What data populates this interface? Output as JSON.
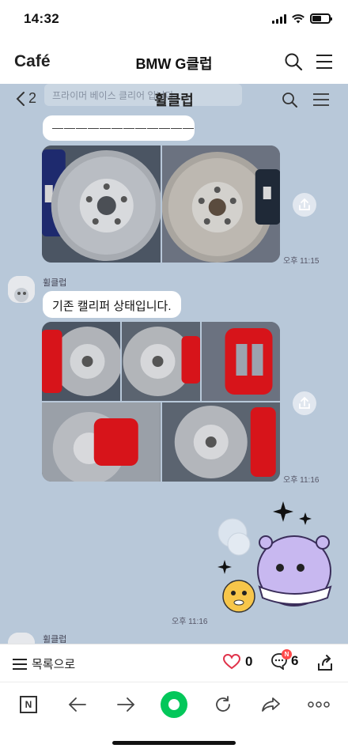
{
  "status_bar": {
    "time": "14:32"
  },
  "cafe_header": {
    "logo": "Café",
    "title": "BMW G클럽"
  },
  "chat_room": {
    "back_count": "2",
    "title": "휠클럽",
    "notice_ghost": "프라이머 베이스 클리어 입니다.",
    "messages": [
      {
        "text": "————————————",
        "time": ""
      },
      {
        "time": "오후 11:15"
      },
      {
        "sender": "휠클럽",
        "text": "기존 캘리퍼 상태입니다.",
        "time": "오후 11:16"
      },
      {
        "time": "오후 11:16"
      },
      {
        "sender": "휠클럽"
      }
    ]
  },
  "post_bar": {
    "list_label": "목록으로",
    "likes": "0",
    "comments": "6",
    "new_badge": "N"
  },
  "nav": {
    "n_label": "N"
  },
  "colors": {
    "chat_bg": "#b8c8d9",
    "caliper_red": "#d7141a",
    "nav_green": "#03c75a",
    "like_red": "#e0324a"
  },
  "icons": [
    "search-icon",
    "menu-icon",
    "chevron-left-icon",
    "share-icon",
    "heart-icon",
    "comment-icon",
    "export-icon",
    "back-arrow-icon",
    "forward-arrow-icon",
    "refresh-icon",
    "more-icon"
  ]
}
